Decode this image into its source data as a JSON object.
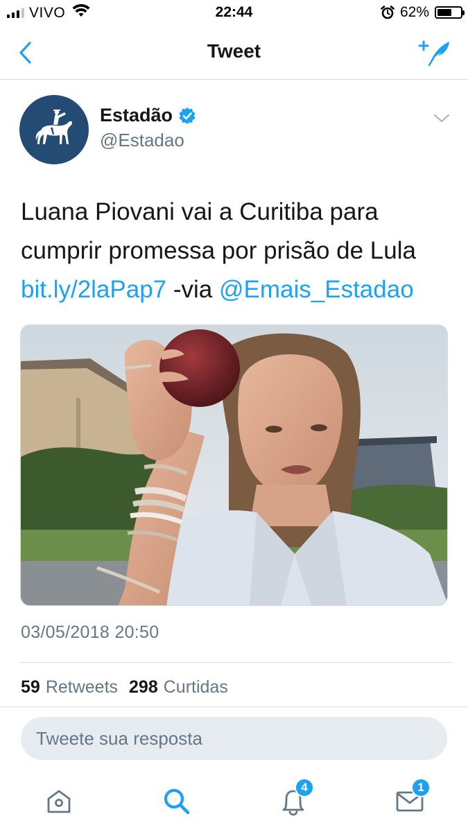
{
  "status_bar": {
    "carrier": "VIVO",
    "time": "22:44",
    "battery": "62%",
    "battery_level": 0.62,
    "icons": [
      "signal-icon",
      "wifi-icon",
      "alarm-icon",
      "battery-icon"
    ]
  },
  "nav": {
    "title": "Tweet",
    "back_icon": "chevron-left-icon",
    "compose_icon": "compose-tweet-icon"
  },
  "tweet": {
    "author": {
      "name": "Estadão",
      "handle": "@Estadao",
      "verified": true,
      "avatar_icon": "horse-rider-logo"
    },
    "text_main": "Luana Piovani vai a Curitiba para cumprir promessa por prisão de Lula",
    "link": "bit.ly/2laPap7",
    "via_text": " -via ",
    "mention": "@Emais_Estadao",
    "timestamp": "03/05/2018 20:50",
    "retweets_count": "59",
    "retweets_label": "Retweets",
    "likes_count": "298",
    "likes_label": "Curtidas"
  },
  "reply": {
    "placeholder": "Tweete sua resposta"
  },
  "tab_bar": {
    "notifications_badge": "4",
    "messages_badge": "1"
  },
  "colors": {
    "accent": "#1da1f2",
    "text_primary": "#14171a",
    "text_secondary": "#657786",
    "avatar_bg": "#244b73"
  }
}
